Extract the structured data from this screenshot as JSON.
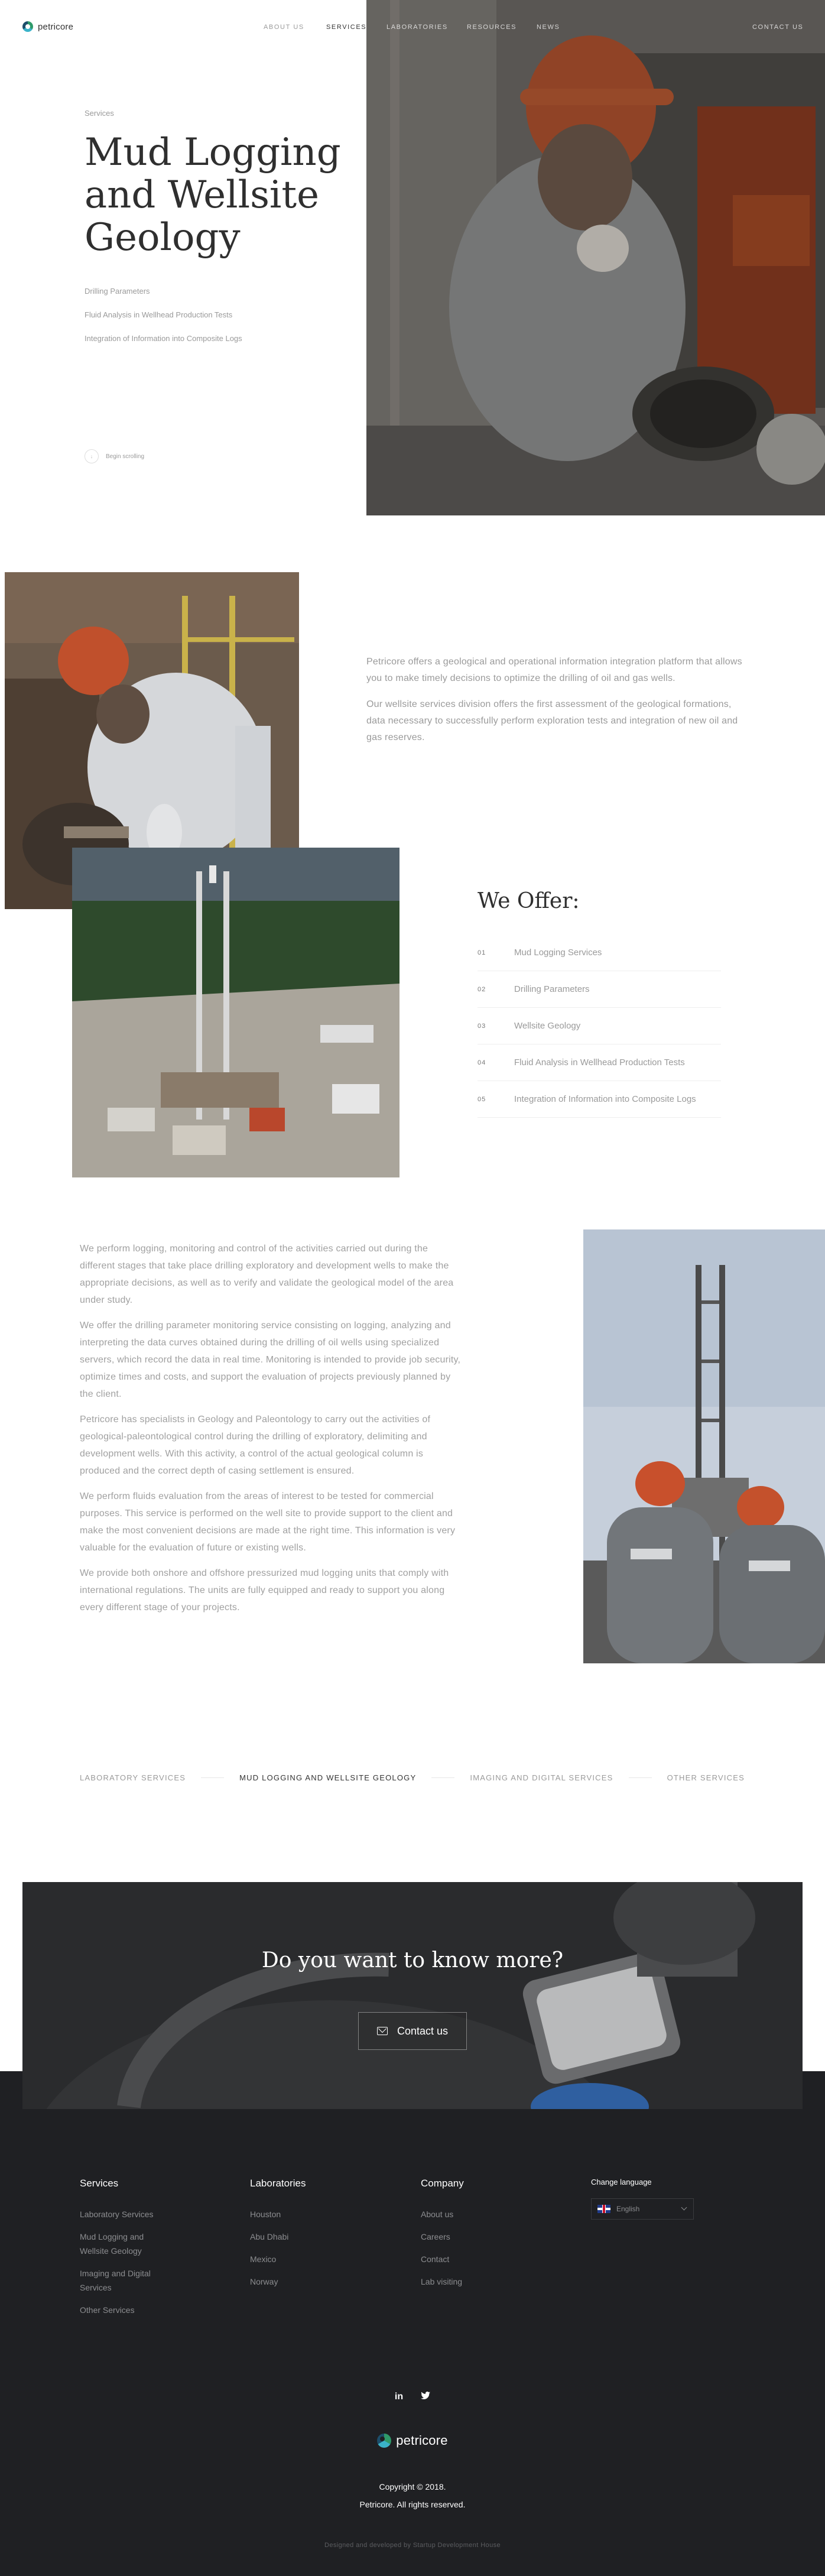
{
  "brand": {
    "name": "petricore"
  },
  "nav": {
    "items": [
      {
        "label": "ABOUT US",
        "active": false
      },
      {
        "label": "SERVICES",
        "active": true
      },
      {
        "label": "LABORATORIES",
        "active": false
      },
      {
        "label": "RESOURCES",
        "active": false
      },
      {
        "label": "NEWS",
        "active": false
      }
    ],
    "contact_label": "CONTACT US"
  },
  "hero": {
    "eyebrow": "Services",
    "title": "Mud Logging and Wellsite Geology",
    "links": [
      "Drilling Parameters",
      "Fluid Analysis in Wellhead Production Tests",
      "Integration of Information into Composite Logs"
    ],
    "scroll_label": "Begin scrolling"
  },
  "intro": {
    "paragraphs": [
      "Petricore offers a geological and operational information integration platform that allows you to make timely decisions to optimize the drilling of oil and gas wells.",
      "Our wellsite services division offers the first assessment of the geological formations, data necessary to successfully perform exploration tests and integration of new oil and gas reserves."
    ]
  },
  "offer": {
    "title": "We Offer:",
    "items": [
      {
        "num": "01",
        "label": "Mud Logging Services"
      },
      {
        "num": "02",
        "label": "Drilling Parameters"
      },
      {
        "num": "03",
        "label": "Wellsite Geology"
      },
      {
        "num": "04",
        "label": "Fluid Analysis in Wellhead Production Tests"
      },
      {
        "num": "05",
        "label": "Integration of Information into Composite Logs"
      }
    ]
  },
  "details": {
    "paragraphs": [
      "We perform logging, monitoring and control of the activities carried out during the different stages that take place drilling exploratory and development wells to make the appropriate decisions, as well as to verify and validate the geological model of the area under study.",
      "We offer the drilling parameter monitoring service consisting on logging, analyzing and interpreting the data curves obtained during the drilling of oil wells using specialized servers, which record the data in real time. Monitoring is intended to provide job security, optimize times and costs, and support the evaluation of projects previously planned by the client.",
      "Petricore has specialists in Geology and Paleontology to carry out the activities of geological-paleontological control during the drilling of exploratory, delimiting and development wells. With this activity, a control of the actual geological column is produced and the correct depth of casing settlement is ensured.",
      "We perform fluids evaluation from the areas of interest to be tested for commercial purposes. This service is performed on the well site to provide support to the client and make the most convenient decisions are made at the right time. This information is very valuable for the evaluation of future or existing wells.",
      "We provide both onshore and offshore pressurized mud logging units that comply with international regulations. The units are fully equipped and ready to support you along every different stage of your projects."
    ]
  },
  "service_tabs": [
    {
      "label": "LABORATORY SERVICES",
      "active": false
    },
    {
      "label": "MUD LOGGING AND WELLSITE GEOLOGY",
      "active": true
    },
    {
      "label": "IMAGING AND DIGITAL SERVICES",
      "active": false
    },
    {
      "label": "OTHER SERVICES",
      "active": false
    }
  ],
  "cta": {
    "title": "Do you want to know more?",
    "button_label": "Contact us"
  },
  "footer": {
    "columns": [
      {
        "title": "Services",
        "links": [
          "Laboratory Services",
          "Mud Logging and Wellsite Geology",
          "Imaging and Digital Services",
          "Other Services"
        ]
      },
      {
        "title": "Laboratories",
        "links": [
          "Houston",
          "Abu Dhabi",
          "Mexico",
          "Norway"
        ]
      },
      {
        "title": "Company",
        "links": [
          "About us",
          "Careers",
          "Contact",
          "Lab visiting"
        ]
      }
    ],
    "language": {
      "title": "Change language",
      "selected": "English"
    },
    "socials": [
      {
        "label": "in",
        "icon": "linkedin-icon"
      },
      {
        "label": "🐦",
        "icon": "twitter-icon"
      }
    ],
    "copyright_line1": "Copyright © 2018.",
    "copyright_line2": "Petricore. All rights reserved.",
    "credits": "Designed and developed by Startup Development House"
  }
}
